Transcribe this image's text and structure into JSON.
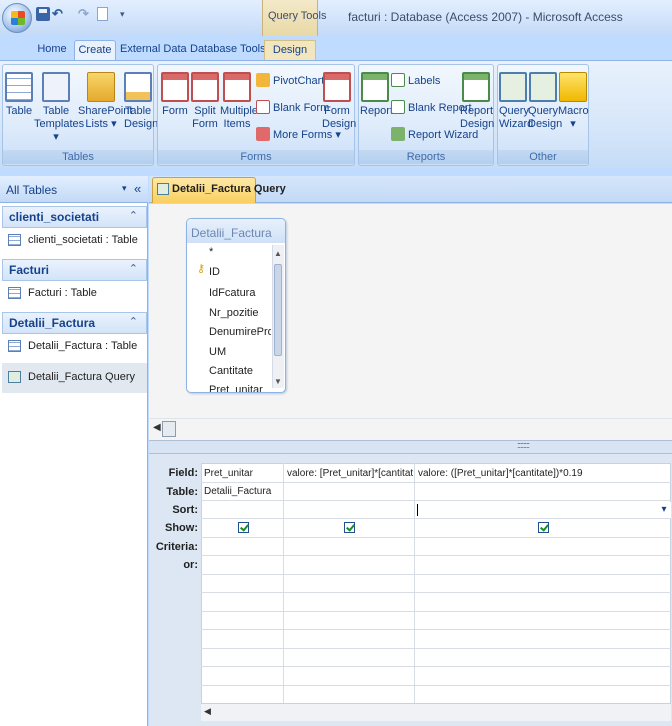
{
  "window": {
    "title": "facturi : Database (Access 2007) - Microsoft Access",
    "contextual_group": "Query Tools",
    "qat_undo": "↶",
    "qat_redo": "↷",
    "qat_customize": "▾"
  },
  "tabs": [
    {
      "label": "Home",
      "active": false
    },
    {
      "label": "Create",
      "active": true
    },
    {
      "label": "External Data",
      "active": false
    },
    {
      "label": "Database Tools",
      "active": false
    },
    {
      "label": "Design",
      "active": false,
      "contextual": true
    }
  ],
  "ribbon": {
    "groups": [
      {
        "label": "Tables",
        "buttons": [
          {
            "label_1": "Table",
            "label_2": "",
            "icon": "table-icon"
          },
          {
            "label_1": "Table",
            "label_2": "Templates ▾",
            "icon": "table-templates-icon"
          },
          {
            "label_1": "SharePoint",
            "label_2": "Lists ▾",
            "icon": "sharepoint-lists-icon"
          },
          {
            "label_1": "Table",
            "label_2": "Design",
            "icon": "table-design-icon"
          }
        ]
      },
      {
        "label": "Forms",
        "buttons": [
          {
            "label_1": "Form",
            "label_2": "",
            "icon": "form-icon"
          },
          {
            "label_1": "Split",
            "label_2": "Form",
            "icon": "split-form-icon"
          },
          {
            "label_1": "Multiple",
            "label_2": "Items",
            "icon": "multiple-items-icon"
          },
          {
            "label_1": "Form",
            "label_2": "Design",
            "icon": "form-design-icon"
          }
        ],
        "small_buttons": [
          {
            "label": "PivotChart",
            "icon": "pivotchart-icon"
          },
          {
            "label": "Blank Form",
            "icon": "blank-form-icon"
          },
          {
            "label": "More Forms ▾",
            "icon": "more-forms-icon"
          }
        ]
      },
      {
        "label": "Reports",
        "buttons": [
          {
            "label_1": "Report",
            "label_2": "",
            "icon": "report-icon"
          },
          {
            "label_1": "Report",
            "label_2": "Design",
            "icon": "report-design-icon"
          }
        ],
        "small_buttons": [
          {
            "label": "Labels",
            "icon": "labels-icon"
          },
          {
            "label": "Blank Report",
            "icon": "blank-report-icon"
          },
          {
            "label": "Report Wizard",
            "icon": "report-wizard-icon"
          }
        ]
      },
      {
        "label": "Other",
        "buttons": [
          {
            "label_1": "Query",
            "label_2": "Wizard",
            "icon": "query-wizard-icon"
          },
          {
            "label_1": "Query",
            "label_2": "Design",
            "icon": "query-design-icon"
          },
          {
            "label_1": "Macro",
            "label_2": "▾",
            "icon": "macro-icon"
          }
        ]
      }
    ]
  },
  "nav_pane": {
    "title": "All Tables",
    "dropdown": "▾",
    "collapse": "«",
    "groups": [
      {
        "label": "clienti_societati",
        "chevron": "⌃",
        "items": [
          {
            "label": "clienti_societati : Table",
            "type": "table",
            "selected": false
          }
        ]
      },
      {
        "label": "Facturi",
        "chevron": "⌃",
        "items": [
          {
            "label": "Facturi : Table",
            "type": "table",
            "selected": false
          }
        ]
      },
      {
        "label": "Detalii_Factura",
        "chevron": "⌃",
        "items": [
          {
            "label": "Detalii_Factura : Table",
            "type": "table",
            "selected": false
          },
          {
            "label": "Detalii_Factura Query",
            "type": "query",
            "selected": true
          }
        ]
      }
    ]
  },
  "document": {
    "tab_label": "Detalii_Factura Query",
    "field_list": {
      "title": "Detalii_Factura",
      "fields": [
        "*",
        "ID",
        "IdFcatura",
        "Nr_pozitie",
        "DenumireProdus",
        "UM",
        "Cantitate",
        "Pret_unitar"
      ],
      "primary_key": "ID"
    },
    "grid": {
      "row_labels": [
        "Field:",
        "Table:",
        "Sort:",
        "Show:",
        "Criteria:",
        "or:"
      ],
      "columns": [
        {
          "field": "Pret_unitar",
          "table": "Detalii_Factura",
          "sort": "",
          "show": true
        },
        {
          "field": "valore: [Pret_unitar]*[cantitate]",
          "table": "",
          "sort": "",
          "show": true
        },
        {
          "field": "valore: ([Pret_unitar]*[cantitate])*0.19",
          "table": "",
          "sort": "",
          "show": true
        }
      ],
      "sort_dropdown": "▾"
    }
  }
}
